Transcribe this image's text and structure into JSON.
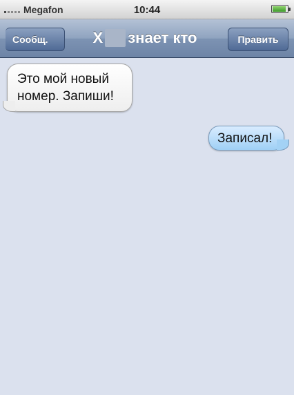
{
  "status_bar": {
    "carrier": "Megafon",
    "time": "10:44",
    "signal_icon": "signal-icon",
    "battery_icon": "battery-icon"
  },
  "nav": {
    "back_label": "Сообщ.",
    "title_prefix": "Х",
    "title_suffix": "знает кто",
    "edit_label": "Править"
  },
  "messages": [
    {
      "direction": "received",
      "text": "Это мой новый номер. Запиши!"
    },
    {
      "direction": "sent",
      "text": "Записал!"
    }
  ],
  "colors": {
    "background": "#dbe1ee",
    "nav_bar": "#8fa3bf",
    "sent_bubble": "#9fd0f5",
    "received_bubble": "#ffffff"
  }
}
